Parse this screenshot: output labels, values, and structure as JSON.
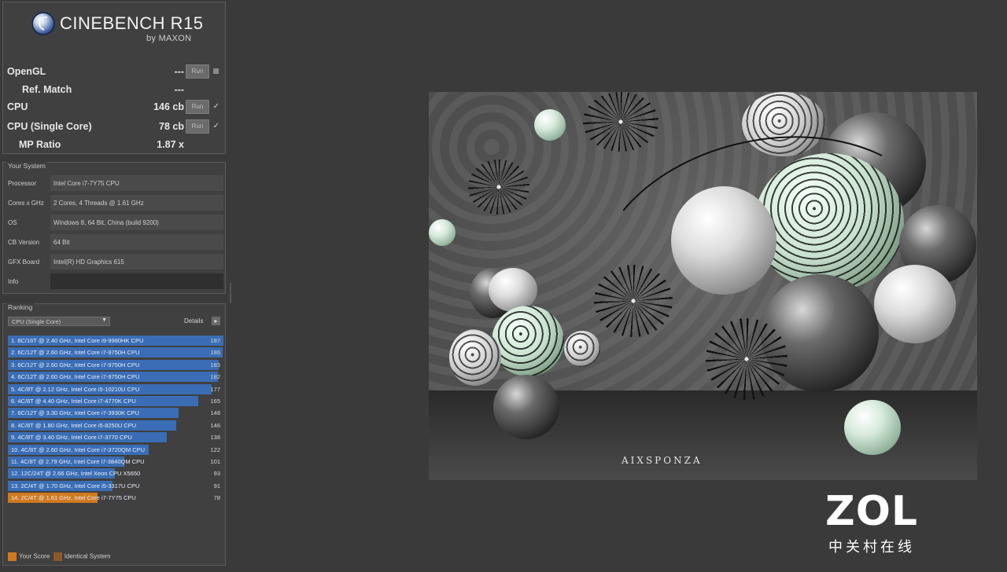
{
  "app": {
    "logo_text": "CINEBENCH R15",
    "logo_byline": "by MAXON"
  },
  "scores": [
    {
      "label": "OpenGL",
      "value": "---",
      "run_label": "Run",
      "status": "square"
    },
    {
      "label": "Ref. Match",
      "value": "---",
      "run_label": "",
      "status": ""
    },
    {
      "label": "CPU",
      "value": "146 cb",
      "run_label": "Run",
      "status": "✓"
    },
    {
      "label": "CPU (Single Core)",
      "value": "78 cb",
      "run_label": "Run",
      "status": "✓"
    },
    {
      "label": "MP Ratio",
      "value": "1.87 x",
      "run_label": "",
      "status": ""
    }
  ],
  "system": {
    "title": "Your System",
    "rows": [
      {
        "key": "Processor",
        "value": "Intel Core i7-7Y75 CPU"
      },
      {
        "key": "Cores x GHz",
        "value": "2 Cores, 4 Threads @ 1.61 GHz"
      },
      {
        "key": "OS",
        "value": "Windows 8, 64 Bit, China (build 9200)"
      },
      {
        "key": "CB Version",
        "value": "64 Bit"
      },
      {
        "key": "GFX Board",
        "value": "Intel(R) HD Graphics 615"
      },
      {
        "key": "Info",
        "value": ""
      }
    ]
  },
  "ranking": {
    "title": "Ranking",
    "dropdown_value": "CPU (Single Core)",
    "details_label": "Details",
    "max_score": 187,
    "rows": [
      {
        "label": "1. 8C/16T @ 2.40 GHz, Intel Core i9-9980HK CPU",
        "score": 187,
        "you": false
      },
      {
        "label": "2. 6C/12T @ 2.60 GHz, Intel Core i7-9750H CPU",
        "score": 186,
        "you": false
      },
      {
        "label": "3. 6C/12T @ 2.60 GHz, Intel Core i7-9750H CPU",
        "score": 183,
        "you": false
      },
      {
        "label": "4. 6C/12T @ 2.60 GHz, Intel Core i7-9750H CPU",
        "score": 182,
        "you": false
      },
      {
        "label": "5. 4C/8T @ 2.12 GHz, Intel Core i5-10210U CPU",
        "score": 177,
        "you": false
      },
      {
        "label": "6. 4C/8T @ 4.40 GHz, Intel Core i7-4770K CPU",
        "score": 165,
        "you": false
      },
      {
        "label": "7. 6C/12T @ 3.30 GHz, Intel Core i7-3930K CPU",
        "score": 148,
        "you": false
      },
      {
        "label": "8. 4C/8T @ 1.80 GHz, Intel Core i5-8250U CPU",
        "score": 146,
        "you": false
      },
      {
        "label": "9. 4C/8T @ 3.40 GHz, Intel Core i7-3770 CPU",
        "score": 138,
        "you": false
      },
      {
        "label": "10. 4C/8T @ 2.60 GHz, Intel Core i7-3720QM CPU",
        "score": 122,
        "you": false
      },
      {
        "label": "11. 4C/8T @ 2.79 GHz, Intel Core i7-3840QM CPU",
        "score": 101,
        "you": false
      },
      {
        "label": "12. 12C/24T @ 2.66 GHz, Intel Xeon CPU X5650",
        "score": 93,
        "you": false
      },
      {
        "label": "13. 2C/4T @ 1.70 GHz, Intel Core i5-3317U CPU",
        "score": 91,
        "you": false
      },
      {
        "label": "14. 2C/4T @ 1.61 GHz, Intel Core i7-7Y75 CPU",
        "score": 78,
        "you": true
      }
    ],
    "legend": {
      "your_score": "Your Score",
      "identical": "Identical System",
      "your_color": "#d07a20",
      "identical_color": "#8a5a2a"
    }
  },
  "render": {
    "brand": "AIXSPONZA"
  },
  "watermark": {
    "logo": "ZOL",
    "subtitle": "中关村在线"
  }
}
